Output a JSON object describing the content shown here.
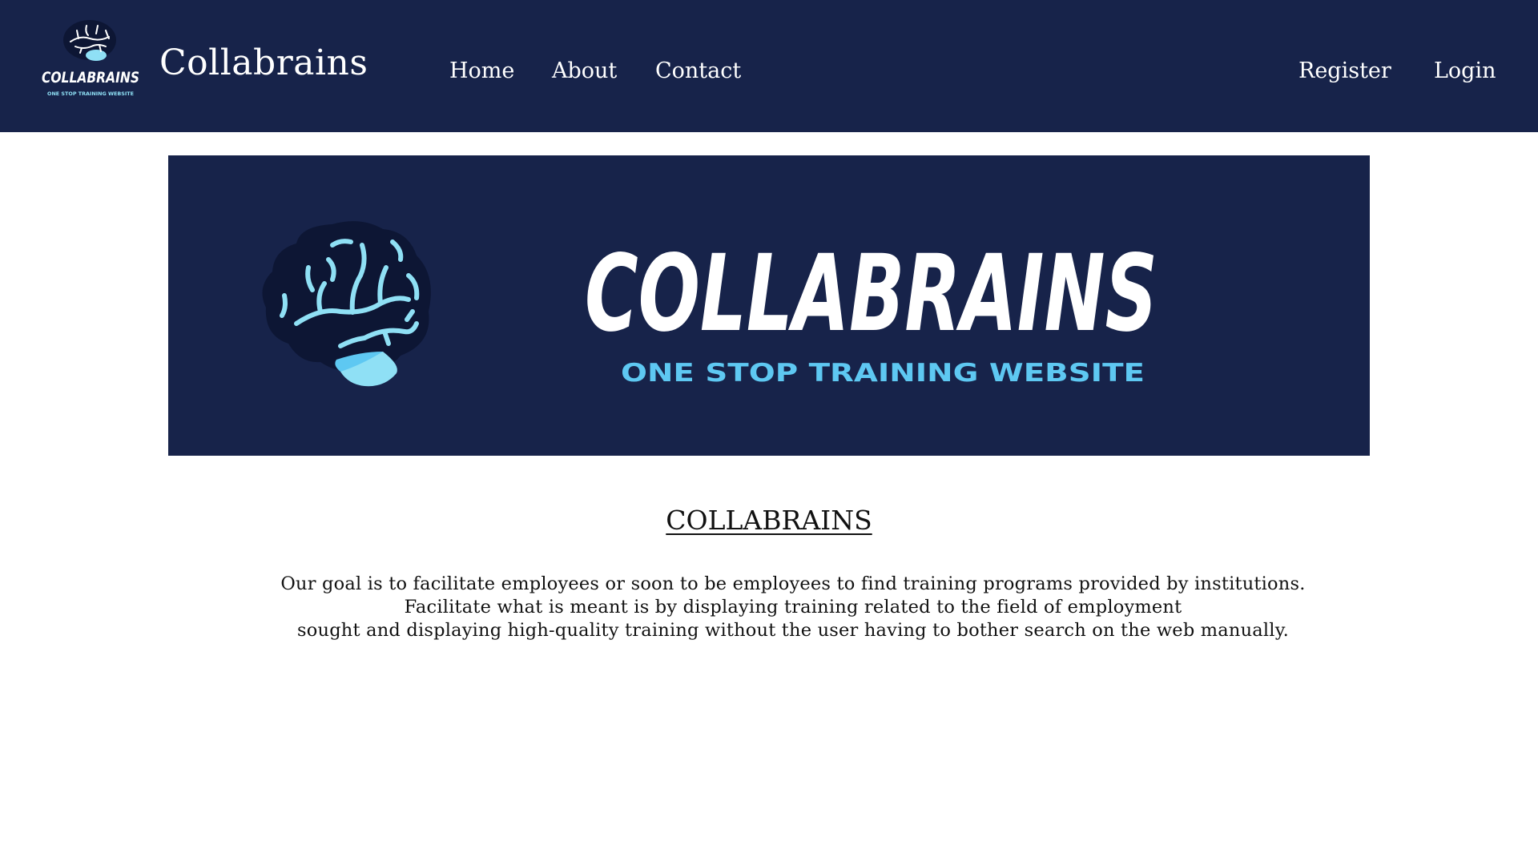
{
  "navbar": {
    "logo": {
      "wordmark": "COLLABRAINS",
      "tagline": "ONE STOP TRAINING WEBSITE",
      "icon": "brain-icon"
    },
    "brand_name": "Collabrains",
    "links": {
      "home": "Home",
      "about": "About",
      "contact": "Contact"
    },
    "auth": {
      "register": "Register",
      "login": "Login"
    }
  },
  "banner": {
    "wordmark": "COLLABRAINS",
    "tagline": "ONE STOP TRAINING WEBSITE",
    "icon": "brain-icon"
  },
  "content": {
    "title": "COLLABRAINS",
    "description": {
      "line1": "Our goal is to facilitate employees or soon to be employees to find training programs provided by institutions.",
      "line2": "Facilitate what is meant is by displaying training related to the field of employment",
      "line3": "sought and displaying high-quality training without the user having to bother search on the web manually."
    }
  },
  "colors": {
    "navy": "#17234a",
    "brain_dark": "#0d1634",
    "brain_light": "#8fe0f5",
    "tagline_blue": "#5ec8f2",
    "white": "#ffffff"
  }
}
